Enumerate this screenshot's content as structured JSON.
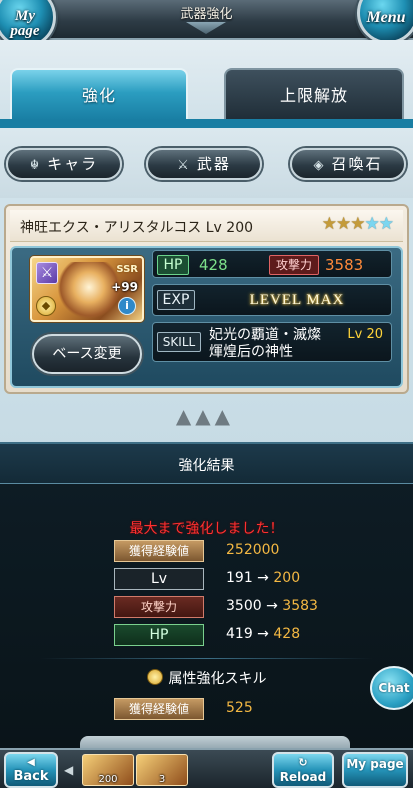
{
  "header": {
    "title": "武器強化",
    "left_button": "My page",
    "right_button": "Menu"
  },
  "tabs": [
    {
      "label": "強化",
      "active": true
    },
    {
      "label": "上限解放",
      "active": false
    }
  ],
  "categories": [
    {
      "label": "キャラ",
      "icon": "character-icon"
    },
    {
      "label": "武器",
      "icon": "crossed-swords-icon"
    },
    {
      "label": "召喚石",
      "icon": "crystal-icon"
    }
  ],
  "weapon": {
    "name": "神旺エクス・アリスタルコス Lv 200",
    "stars_gold": "★★★",
    "stars_blue": "★★",
    "ssr": "SSR",
    "plus": "+99",
    "base_change": "ベース変更",
    "hp_label": "HP",
    "hp": "428",
    "atk_label": "攻撃力",
    "atk": "3583",
    "exp_label": "EXP",
    "exp_text": "LEVEL MAX",
    "skill_label": "SKILL",
    "skill_name": "妃光の覇道・滅燦煇煌后の神性",
    "skill_lv": "Lv 20"
  },
  "result": {
    "title": "強化結果",
    "message": "最大まで強化しました！",
    "rows": [
      {
        "label": "獲得経験値",
        "value": "252000"
      },
      {
        "label": "Lv",
        "from": "191",
        "to": "200"
      },
      {
        "label": "攻撃力",
        "from": "3500",
        "to": "3583"
      },
      {
        "label": "HP",
        "from": "419",
        "to": "428"
      }
    ],
    "element_skill_title": "属性強化スキル",
    "element_exp_label": "獲得経験値",
    "element_exp_value": "525"
  },
  "footer": {
    "back": "Back",
    "reload": "Reload",
    "mypage": "My page",
    "chat": "Chat",
    "item_1_count": "200",
    "item_2_count": "3"
  }
}
